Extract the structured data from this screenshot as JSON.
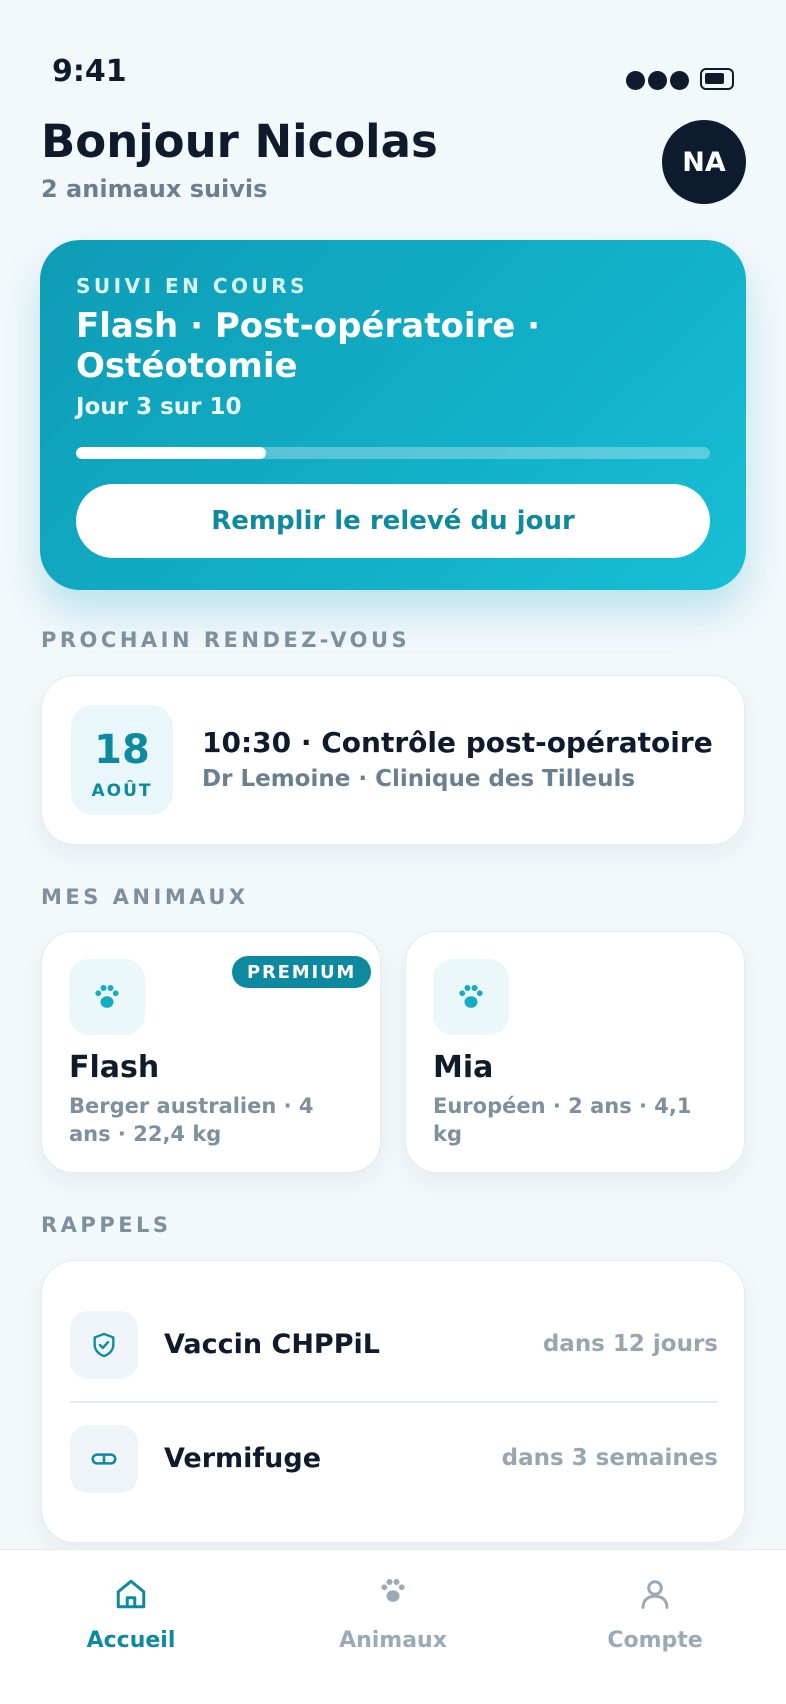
{
  "status_bar": {
    "time": "9:41"
  },
  "header": {
    "greeting": "Bonjour Nicolas",
    "subtitle": "2 animaux suivis",
    "avatar_initials": "NA"
  },
  "hero": {
    "eyebrow": "SUIVI EN COURS",
    "title": "Flash · Post-opératoire · Ostéotomie",
    "day_text": "Jour 3 sur 10",
    "progress_fraction": 0.3,
    "button_label": "Remplir le relevé du jour",
    "accent_color": "#12b0c8"
  },
  "appointment": {
    "section_title": "PROCHAIN RENDEZ-VOUS",
    "day": "18",
    "month": "AOÛT",
    "title": "10:30 · Contrôle post-opératoire",
    "details": "Dr Lemoine · Clinique des Tilleuls"
  },
  "pets": {
    "section_title": "MES ANIMAUX",
    "items": [
      {
        "name": "Flash",
        "info": "Berger australien · 4 ans · 22,4 kg",
        "badge": "PREMIUM",
        "icon": "paw-icon"
      },
      {
        "name": "Mia",
        "info": "Européen · 2 ans · 4,1 kg",
        "icon": "paw-icon"
      }
    ]
  },
  "reminders": {
    "section_title": "RAPPELS",
    "items": [
      {
        "label": "Vaccin CHPPiL",
        "when": "dans 12 jours",
        "icon": "shield-check-icon"
      },
      {
        "label": "Vermifuge",
        "when": "dans 3 semaines",
        "icon": "pill-icon"
      }
    ]
  },
  "tabbar": {
    "tabs": [
      {
        "label": "Accueil",
        "icon": "home-icon",
        "active": true
      },
      {
        "label": "Animaux",
        "icon": "paw-icon",
        "active": false
      },
      {
        "label": "Compte",
        "icon": "user-icon",
        "active": false
      }
    ]
  },
  "colors": {
    "brand": "#0e8aa0",
    "background": "#f3f8fb",
    "text_primary": "#0f1b2d",
    "text_secondary": "#6a8091"
  }
}
